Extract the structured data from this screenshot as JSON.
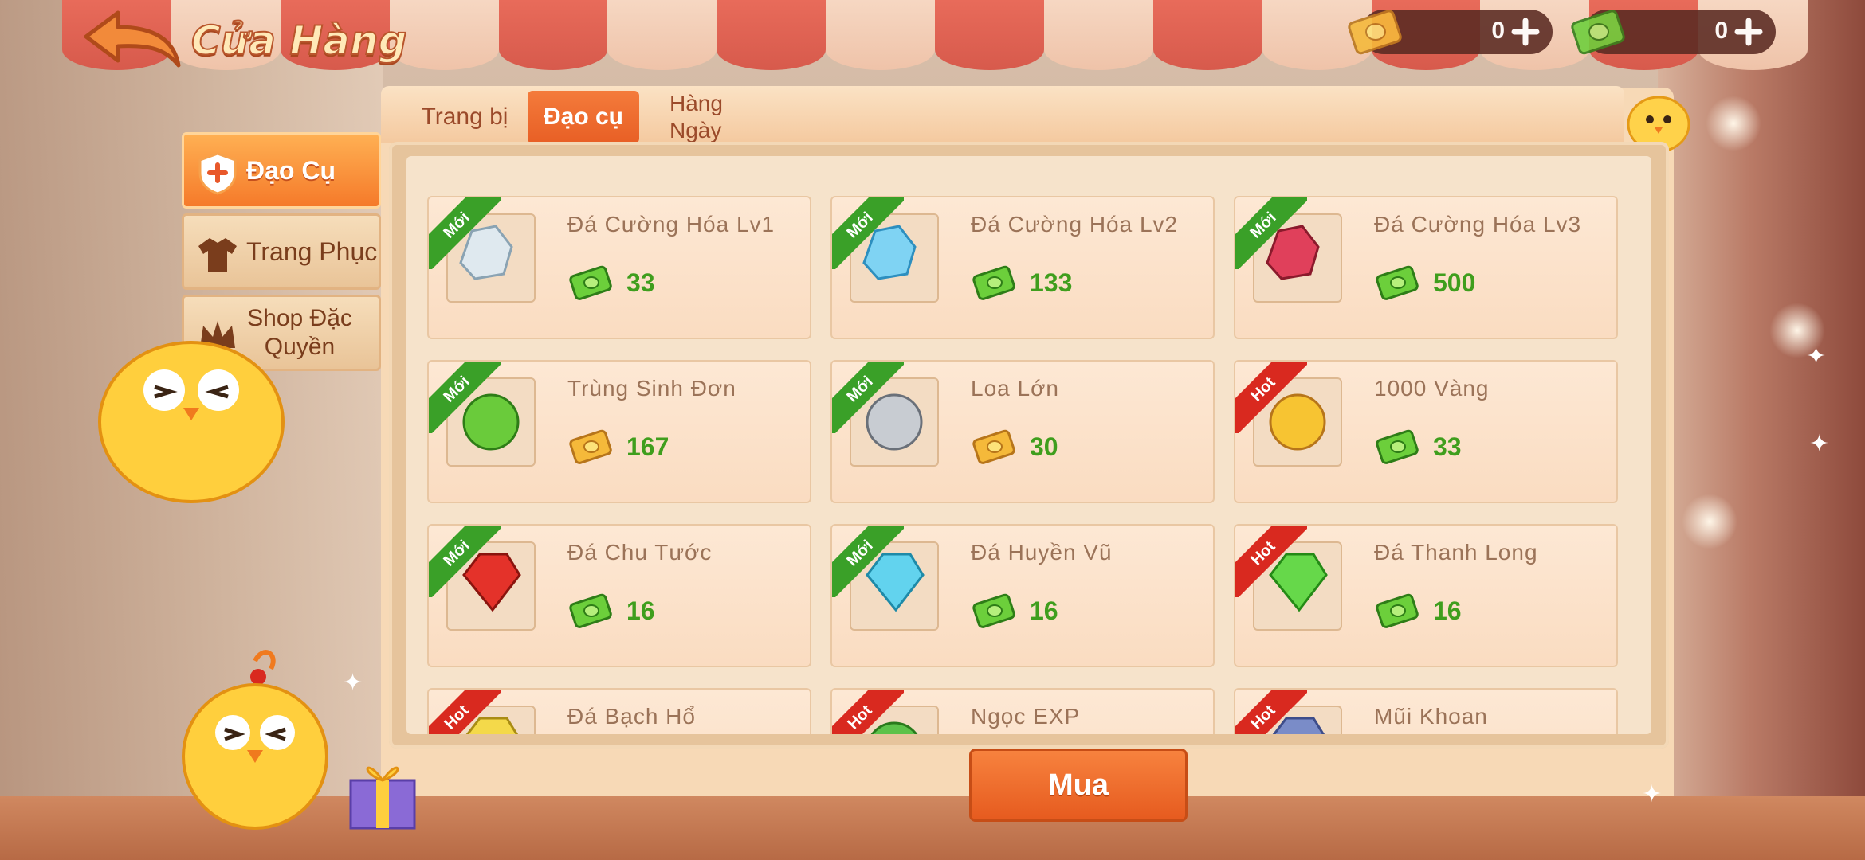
{
  "header": {
    "title": "Cửa Hàng",
    "currencies": [
      {
        "icon": "gold-ticket-icon",
        "value": "0"
      },
      {
        "icon": "green-cash-icon",
        "value": "0"
      }
    ]
  },
  "tabs": [
    {
      "label": "Trang bị",
      "active": false
    },
    {
      "label": "Đạo cụ",
      "active": true
    },
    {
      "label": "Hàng Ngày",
      "active": false
    }
  ],
  "sidebar": {
    "items": [
      {
        "label": "Đạo Cụ",
        "icon": "shield-plus-icon",
        "active": true
      },
      {
        "label": "Trang Phục",
        "icon": "shirt-icon",
        "active": false
      },
      {
        "label": "Shop Đặc Quyền",
        "icon": "crown-icon",
        "active": false
      }
    ]
  },
  "items": [
    {
      "name": "Đá Cường Hóa Lv1",
      "badge": "Mới",
      "badge_type": "moi",
      "currency": "green",
      "price": "33",
      "icon": "white-crystal-icon"
    },
    {
      "name": "Đá Cường Hóa Lv2",
      "badge": "Mới",
      "badge_type": "moi",
      "currency": "green",
      "price": "133",
      "icon": "blue-crystal-icon"
    },
    {
      "name": "Đá Cường Hóa Lv3",
      "badge": "Mới",
      "badge_type": "moi",
      "currency": "green",
      "price": "500",
      "icon": "red-crystal-icon"
    },
    {
      "name": "Trùng Sinh Đơn",
      "badge": "Mới",
      "badge_type": "moi",
      "currency": "gold",
      "price": "167",
      "icon": "green-pill-icon"
    },
    {
      "name": "Loa Lớn",
      "badge": "Mới",
      "badge_type": "moi",
      "currency": "gold",
      "price": "30",
      "icon": "megaphone-icon"
    },
    {
      "name": "1000 Vàng",
      "badge": "Hot",
      "badge_type": "hot",
      "currency": "green",
      "price": "33",
      "icon": "gold-coin-icon"
    },
    {
      "name": "Đá Chu Tước",
      "badge": "Mới",
      "badge_type": "moi",
      "currency": "green",
      "price": "16",
      "icon": "red-gem-icon"
    },
    {
      "name": "Đá Huyền Vũ",
      "badge": "Mới",
      "badge_type": "moi",
      "currency": "green",
      "price": "16",
      "icon": "cyan-gem-icon"
    },
    {
      "name": "Đá Thanh Long",
      "badge": "Hot",
      "badge_type": "hot",
      "currency": "green",
      "price": "16",
      "icon": "green-gem-icon"
    },
    {
      "name": "Đá Bạch Hổ",
      "badge": "Hot",
      "badge_type": "hot",
      "currency": "green",
      "price": "",
      "icon": "yellow-gem-icon"
    },
    {
      "name": "Ngọc EXP",
      "badge": "Hot",
      "badge_type": "hot",
      "currency": "green",
      "price": "",
      "icon": "green-orb-icon"
    },
    {
      "name": "Mũi Khoan",
      "badge": "Hot",
      "badge_type": "hot",
      "currency": "green",
      "price": "",
      "icon": "drill-icon"
    }
  ],
  "buy_button": {
    "label": "Mua"
  },
  "colors": {
    "accent": "#e8622a",
    "price_green": "#3f9e1d",
    "badge_new": "#3aa028",
    "badge_hot": "#d9291f"
  }
}
